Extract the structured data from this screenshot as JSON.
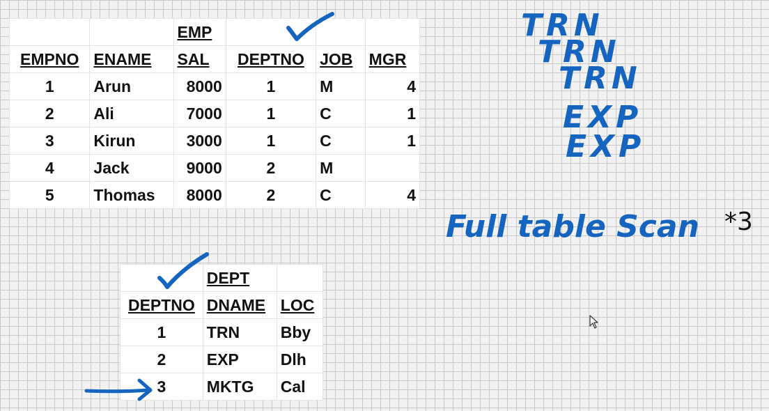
{
  "emp": {
    "title": "EMP",
    "columns": [
      "EMPNO",
      "ENAME",
      "SAL",
      "DEPTNO",
      "JOB",
      "MGR"
    ],
    "rows": [
      [
        "1",
        "Arun",
        "8000",
        "1",
        "M",
        "4"
      ],
      [
        "2",
        "Ali",
        "7000",
        "1",
        "C",
        "1"
      ],
      [
        "3",
        "Kirun",
        "3000",
        "1",
        "C",
        "1"
      ],
      [
        "4",
        "Jack",
        "9000",
        "2",
        "M",
        ""
      ],
      [
        "5",
        "Thomas",
        "8000",
        "2",
        "C",
        "4"
      ]
    ]
  },
  "dept": {
    "title": "DEPT",
    "columns": [
      "DEPTNO",
      "DNAME",
      "LOC"
    ],
    "rows": [
      [
        "1",
        "TRN",
        "Bby"
      ],
      [
        "2",
        "EXP",
        "Dlh"
      ],
      [
        "3",
        "MKTG",
        "Cal"
      ]
    ]
  },
  "annotations": {
    "stack": [
      "TRN",
      "TRN",
      "TRN",
      "EXP",
      "EXP"
    ],
    "note": "Full table Scan",
    "multiplier": "*3",
    "ink_color": "#1565c0"
  }
}
